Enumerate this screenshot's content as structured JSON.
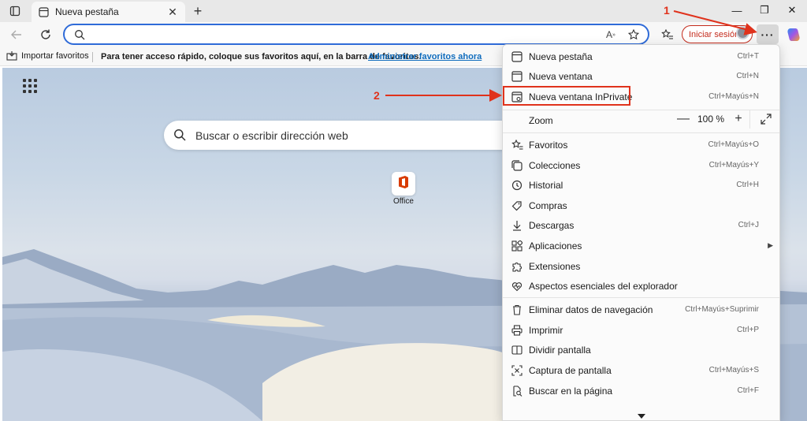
{
  "tab": {
    "title": "Nueva pestaña",
    "close": "✕"
  },
  "window": {
    "minimize": "—",
    "restore": "❐",
    "close": "✕"
  },
  "toolbar": {
    "address_value": "",
    "signin_label": "Iniciar sesión",
    "more_label": "···"
  },
  "favorites_bar": {
    "import_label": "Importar favoritos",
    "message": "Para tener acceso rápido, coloque sus favoritos aquí, en la barra de favoritos.",
    "manage_link": "Administrar favoritos ahora"
  },
  "page": {
    "search_placeholder": "Buscar o escribir dirección web",
    "office_label": "Office"
  },
  "menu": {
    "items": [
      {
        "label": "Nueva pestaña",
        "shortcut": "Ctrl+T",
        "icon": "new-tab-icon"
      },
      {
        "label": "Nueva ventana",
        "shortcut": "Ctrl+N",
        "icon": "new-window-icon"
      },
      {
        "label": "Nueva ventana InPrivate",
        "shortcut": "Ctrl+Mayús+N",
        "icon": "inprivate-icon"
      },
      {
        "label": "Zoom",
        "shortcut": "",
        "icon": ""
      },
      {
        "label": "Favoritos",
        "shortcut": "Ctrl+Mayús+O",
        "icon": "favorites-icon"
      },
      {
        "label": "Colecciones",
        "shortcut": "Ctrl+Mayús+Y",
        "icon": "collections-icon"
      },
      {
        "label": "Historial",
        "shortcut": "Ctrl+H",
        "icon": "history-icon"
      },
      {
        "label": "Compras",
        "shortcut": "",
        "icon": "shopping-tag-icon"
      },
      {
        "label": "Descargas",
        "shortcut": "Ctrl+J",
        "icon": "download-icon"
      },
      {
        "label": "Aplicaciones",
        "shortcut": "",
        "icon": "apps-icon"
      },
      {
        "label": "Extensiones",
        "shortcut": "",
        "icon": "puzzle-icon"
      },
      {
        "label": "Aspectos esenciales del explorador",
        "shortcut": "",
        "icon": "heart-pulse-icon"
      },
      {
        "label": "Eliminar datos de navegación",
        "shortcut": "Ctrl+Mayús+Suprimir",
        "icon": "trash-icon"
      },
      {
        "label": "Imprimir",
        "shortcut": "Ctrl+P",
        "icon": "printer-icon"
      },
      {
        "label": "Dividir pantalla",
        "shortcut": "",
        "icon": "split-screen-icon"
      },
      {
        "label": "Captura de pantalla",
        "shortcut": "Ctrl+Mayús+S",
        "icon": "screenshot-icon"
      },
      {
        "label": "Buscar en la página",
        "shortcut": "Ctrl+F",
        "icon": "find-icon"
      }
    ],
    "zoom": {
      "minus": "—",
      "value": "100 %",
      "plus": "+"
    }
  },
  "annotations": {
    "step1": "1",
    "step2": "2"
  },
  "colors": {
    "accent_red": "#e0321c",
    "address_border": "#2f6bd8",
    "link": "#0f6cbd"
  }
}
